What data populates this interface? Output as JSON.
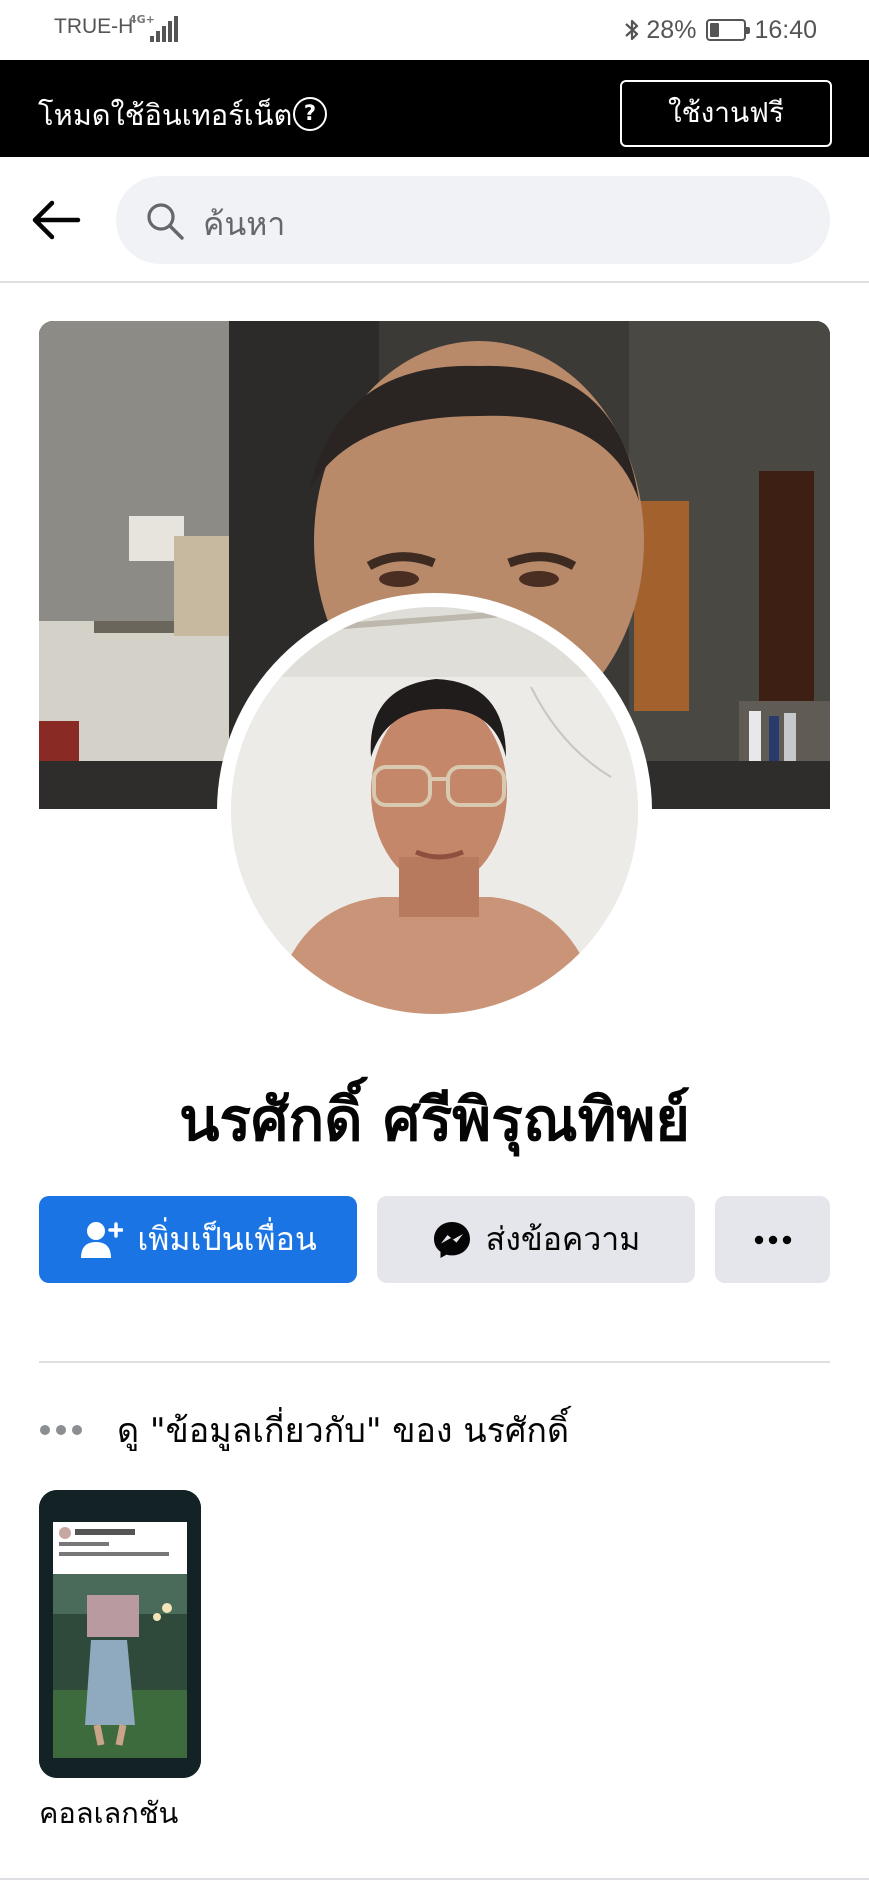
{
  "status_bar": {
    "carrier": "TRUE-H",
    "network": "4G+",
    "battery_percent": "28%",
    "battery_level": 0.28,
    "time": "16:40",
    "icons": [
      "signal-icon",
      "bluetooth-icon",
      "battery-icon"
    ]
  },
  "banner": {
    "text": "โหมดใช้อินเทอร์เน็ต",
    "help_symbol": "?",
    "free_button": "ใช้งานฟรี",
    "colors": {
      "background": "#000000",
      "text": "#ffffff"
    }
  },
  "search": {
    "placeholder": "ค้นหา",
    "icons": [
      "back-arrow-icon",
      "search-icon"
    ]
  },
  "profile": {
    "name": "นรศักดิ์ ศรีพิรุณทิพย์"
  },
  "actions": {
    "add_friend": "เพิ่มเป็นเพื่อน",
    "message": "ส่งข้อความ",
    "icons": [
      "add-friend-icon",
      "messenger-icon",
      "more-icon"
    ],
    "colors": {
      "primary": "#1b74e4",
      "secondary": "#e4e6eb"
    }
  },
  "about": {
    "text": "ดู \"ข้อมูลเกี่ยวกับ\" ของ นรศักดิ์"
  },
  "collections": [
    {
      "label": "คอลเลกชัน"
    }
  ]
}
